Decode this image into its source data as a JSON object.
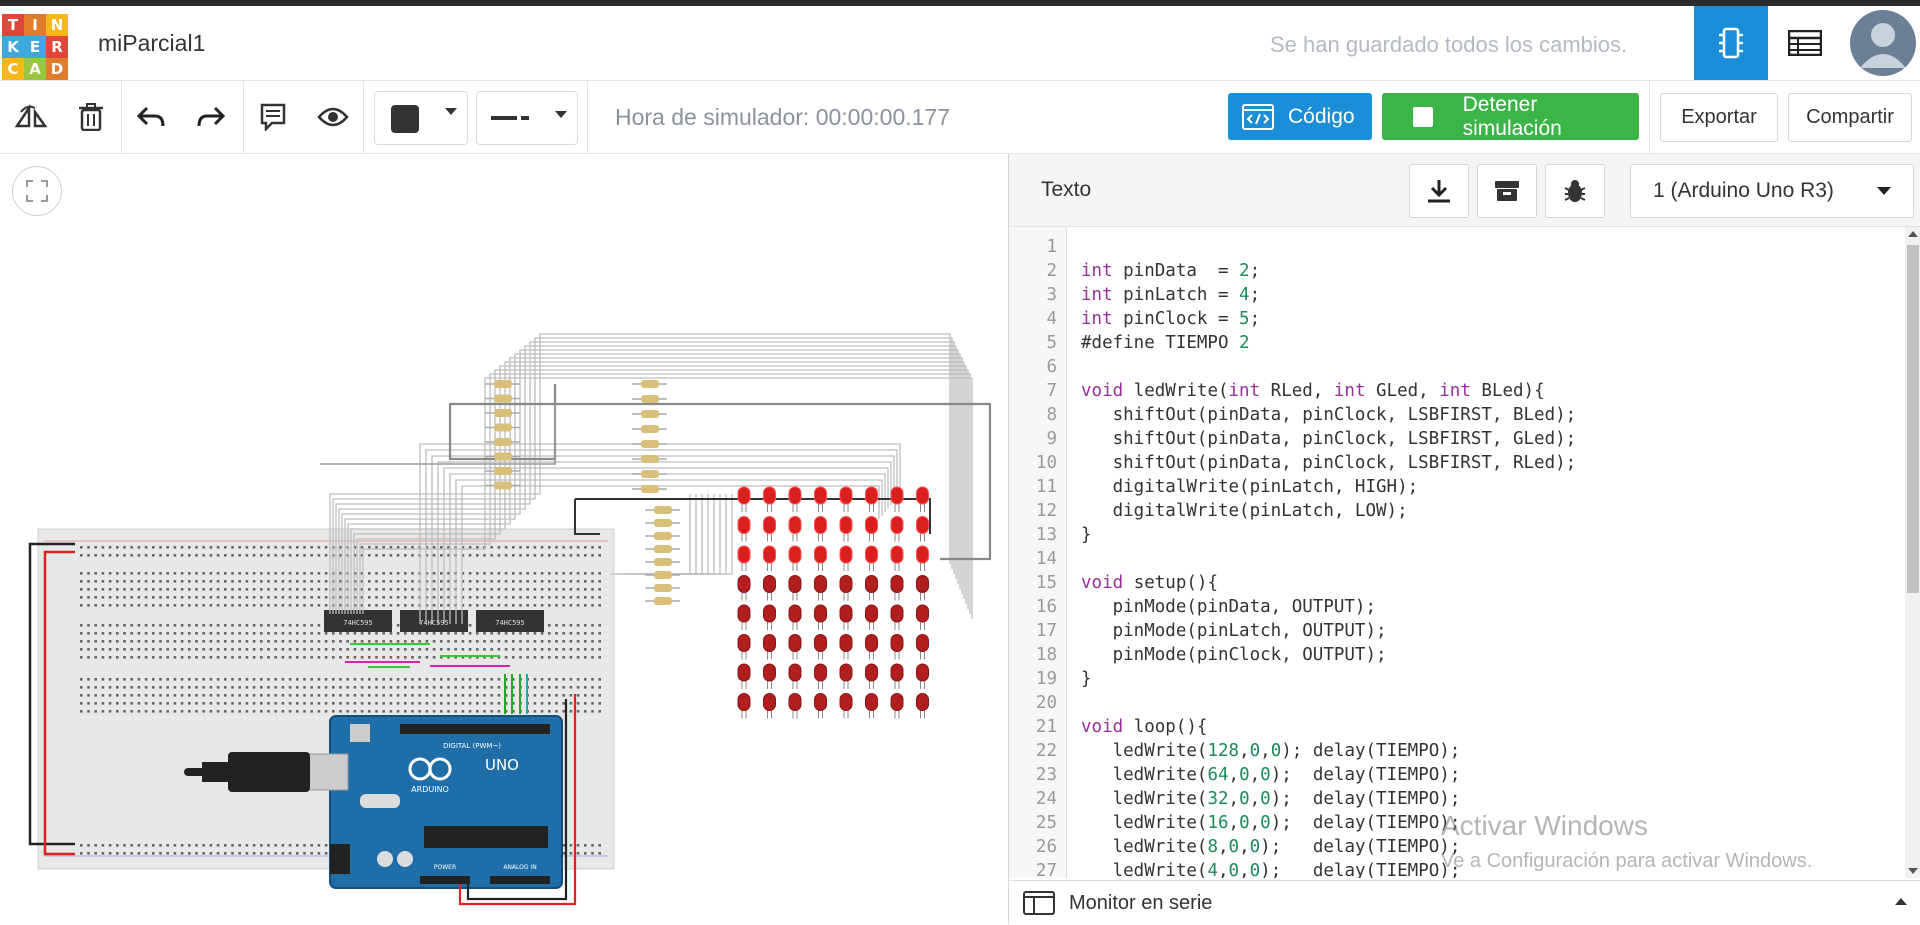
{
  "app": {
    "logo_letters": [
      "T",
      "I",
      "N",
      "K",
      "E",
      "R",
      "C",
      "A",
      "D"
    ],
    "logo_colors": [
      "#e2453c",
      "#e07d2c",
      "#f5b818",
      "#3fa8dd",
      "#3fa8dd",
      "#e2453c",
      "#f5b818",
      "#9bc640",
      "#e07d2c"
    ],
    "project_title": "miParcial1",
    "save_status": "Se han guardado todos los cambios.",
    "accent_color": "#1a8ed8"
  },
  "toolbar": {
    "simulator_time": "Hora de simulador: 00:00:00.177",
    "code_label": "Código",
    "stop_label": "Detener simulación",
    "export_label": "Exportar",
    "share_label": "Compartir"
  },
  "panel": {
    "title": "Texto",
    "board_select": "1 (Arduino Uno R3)",
    "serial_monitor": "Monitor en serie"
  },
  "code_lines": [
    "",
    "int pinData  = 2;",
    "int pinLatch = 4;",
    "int pinClock = 5;",
    "#define TIEMPO 2",
    "",
    "void ledWrite(int RLed, int GLed, int BLed){",
    "   shiftOut(pinData, pinClock, LSBFIRST, BLed);",
    "   shiftOut(pinData, pinClock, LSBFIRST, GLed);",
    "   shiftOut(pinData, pinClock, LSBFIRST, RLed);",
    "   digitalWrite(pinLatch, HIGH);",
    "   digitalWrite(pinLatch, LOW);",
    "}",
    "",
    "void setup(){",
    "   pinMode(pinData, OUTPUT);",
    "   pinMode(pinLatch, OUTPUT);",
    "   pinMode(pinClock, OUTPUT);",
    "}",
    "",
    "void loop(){",
    "   ledWrite(128,0,0); delay(TIEMPO);",
    "   ledWrite(64,0,0);  delay(TIEMPO);",
    "   ledWrite(32,0,0);  delay(TIEMPO);",
    "   ledWrite(16,0,0);  delay(TIEMPO);",
    "   ledWrite(8,0,0);   delay(TIEMPO);",
    "   ledWrite(4,0,0);   delay(TIEMPO);"
  ],
  "circuit": {
    "chip_label": "74HC595",
    "board_label": "UNO",
    "board_brand": "ARDUINO",
    "digital_label": "DIGITAL (PWM~)",
    "power_label": "POWER",
    "analog_label": "ANALOG IN"
  },
  "watermark": {
    "line1": "Activar Windows",
    "line2": "Ve a Configuración para activar Windows."
  }
}
